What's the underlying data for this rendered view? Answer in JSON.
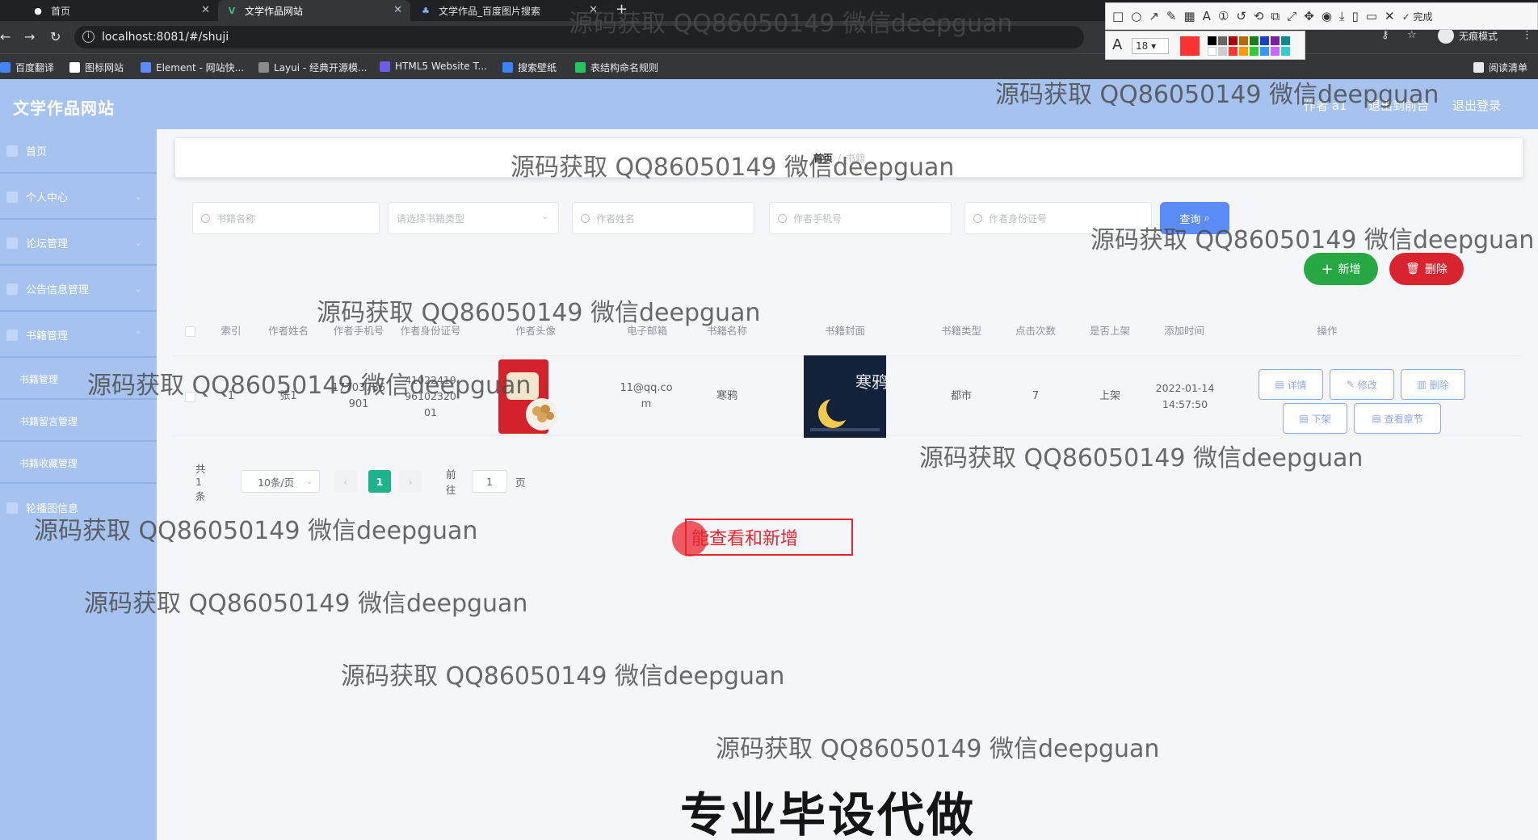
{
  "browser": {
    "tabs": [
      {
        "title": "首页",
        "active": false
      },
      {
        "title": "文学作品网站",
        "active": true
      },
      {
        "title": "文学作品_百度图片搜索",
        "active": false
      }
    ],
    "url": "localhost:8081/#/shuji",
    "incognito_label": "无痕模式",
    "bookmarks": [
      "百度翻译",
      "图标网站",
      "Element - 网站快...",
      "Layui - 经典开源模...",
      "HTML5 Website T...",
      "搜索壁纸",
      "表结构命名规则"
    ],
    "reading_list": "阅读清单"
  },
  "annotation_toolbar": {
    "font_size": "18",
    "done_label": "完成",
    "current_color": "#ff3333"
  },
  "app": {
    "brand": "文学作品网站",
    "top_links": [
      "作者 a1",
      "退出到前台",
      "退出登录"
    ]
  },
  "sidebar": {
    "menus": [
      "首页",
      "个人中心",
      "论坛管理",
      "公告信息管理",
      "书籍管理"
    ],
    "submenus": [
      "书籍管理",
      "书籍留言管理",
      "书籍收藏管理"
    ],
    "last_menu": "轮播图信息"
  },
  "breadcrumb": {
    "home": "首页",
    "current": "书籍"
  },
  "search": {
    "book_name": "书籍名称",
    "book_type": "请选择书籍类型",
    "author_name": "作者姓名",
    "author_phone": "作者手机号",
    "author_id": "作者身份证号",
    "query_label": "查询"
  },
  "actions": {
    "add": "新增",
    "delete": "删除"
  },
  "table": {
    "headers": [
      "索引",
      "作者姓名",
      "作者手机号",
      "作者身份证号",
      "作者头像",
      "电子邮箱",
      "书籍名称",
      "书籍封面",
      "书籍类型",
      "点击次数",
      "是否上架",
      "添加时间",
      "操作"
    ],
    "rows": [
      {
        "index": "1",
        "author": "张1",
        "phone": "17703786901",
        "id_card": "410224199610232001",
        "email": "11@qq.com",
        "book": "寒鸦",
        "cover_title": "寒鸦",
        "type": "都市",
        "clicks": "7",
        "status": "上架",
        "time": "2022-01-14 14:57:50"
      }
    ],
    "row_buttons": [
      "详情",
      "修改",
      "删除",
      "下架",
      "查看章节"
    ]
  },
  "pagination": {
    "total": "共 1 条",
    "page_size": "10条/页",
    "current": "1",
    "goto_prefix": "前往",
    "goto_value": "1",
    "goto_suffix": "页"
  },
  "overlay": {
    "watermark": "源码获取 QQ86050149 微信deepguan",
    "callout": "能查看和新增",
    "caption": "专业毕设代做"
  }
}
